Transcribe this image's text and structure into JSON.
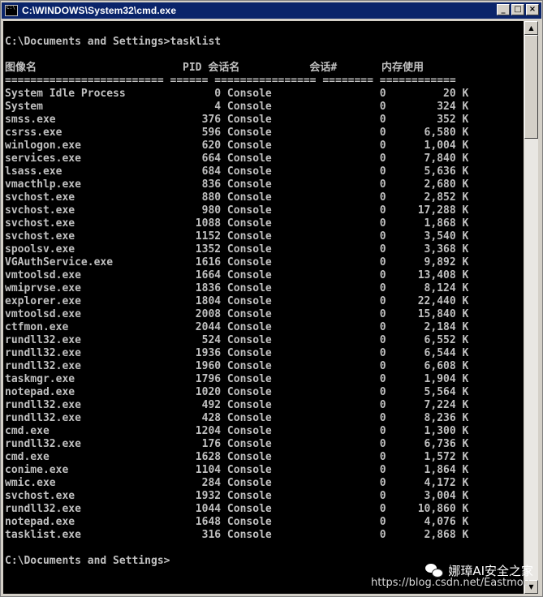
{
  "window": {
    "title": "C:\\WINDOWS\\System32\\cmd.exe",
    "buttons": {
      "minimize": "_",
      "maximize": "□",
      "close": "×"
    }
  },
  "console": {
    "prompt_command": "C:\\Documents and Settings>tasklist",
    "header": "图像名                       PID 会话名           会话#       内存使用",
    "separator": "========================= ====== ================ ======== ============",
    "processes": [
      "System Idle Process              0 Console                 0         20 K",
      "System                           4 Console                 0        324 K",
      "smss.exe                       376 Console                 0        352 K",
      "csrss.exe                      596 Console                 0      6,580 K",
      "winlogon.exe                   620 Console                 0      1,004 K",
      "services.exe                   664 Console                 0      7,840 K",
      "lsass.exe                      684 Console                 0      5,636 K",
      "vmacthlp.exe                   836 Console                 0      2,680 K",
      "svchost.exe                    880 Console                 0      2,852 K",
      "svchost.exe                    980 Console                 0     17,288 K",
      "svchost.exe                   1088 Console                 0      1,868 K",
      "svchost.exe                   1152 Console                 0      3,540 K",
      "spoolsv.exe                   1352 Console                 0      3,368 K",
      "VGAuthService.exe             1616 Console                 0      9,892 K",
      "vmtoolsd.exe                  1664 Console                 0     13,408 K",
      "wmiprvse.exe                  1836 Console                 0      8,124 K",
      "explorer.exe                  1804 Console                 0     22,440 K",
      "vmtoolsd.exe                  2008 Console                 0     15,840 K",
      "ctfmon.exe                    2044 Console                 0      2,184 K",
      "rundll32.exe                   524 Console                 0      6,552 K",
      "rundll32.exe                  1936 Console                 0      6,544 K",
      "rundll32.exe                  1960 Console                 0      6,608 K",
      "taskmgr.exe                   1796 Console                 0      1,904 K",
      "notepad.exe                   1020 Console                 0      5,564 K",
      "rundll32.exe                   492 Console                 0      7,224 K",
      "rundll32.exe                   428 Console                 0      8,236 K",
      "cmd.exe                       1204 Console                 0      1,300 K",
      "rundll32.exe                   176 Console                 0      6,736 K",
      "cmd.exe                       1628 Console                 0      1,572 K",
      "conime.exe                    1104 Console                 0      1,864 K",
      "wmic.exe                       284 Console                 0      4,172 K",
      "svchost.exe                   1932 Console                 0      3,004 K",
      "rundll32.exe                  1044 Console                 0     10,860 K",
      "notepad.exe                   1648 Console                 0      4,076 K",
      "tasklist.exe                   316 Console                 0      2,868 K"
    ],
    "final_prompt": "C:\\Documents and Settings>"
  },
  "overlay": {
    "wechat_name": "娜璋AI安全之家",
    "url": "https://blog.csdn.net/Eastmou"
  },
  "colors": {
    "titlebar": "#0a246a",
    "console_bg": "#000000",
    "console_text": "#c0c0c0"
  },
  "icons": {
    "title": "cmd-icon",
    "wechat": "wechat-icon"
  }
}
